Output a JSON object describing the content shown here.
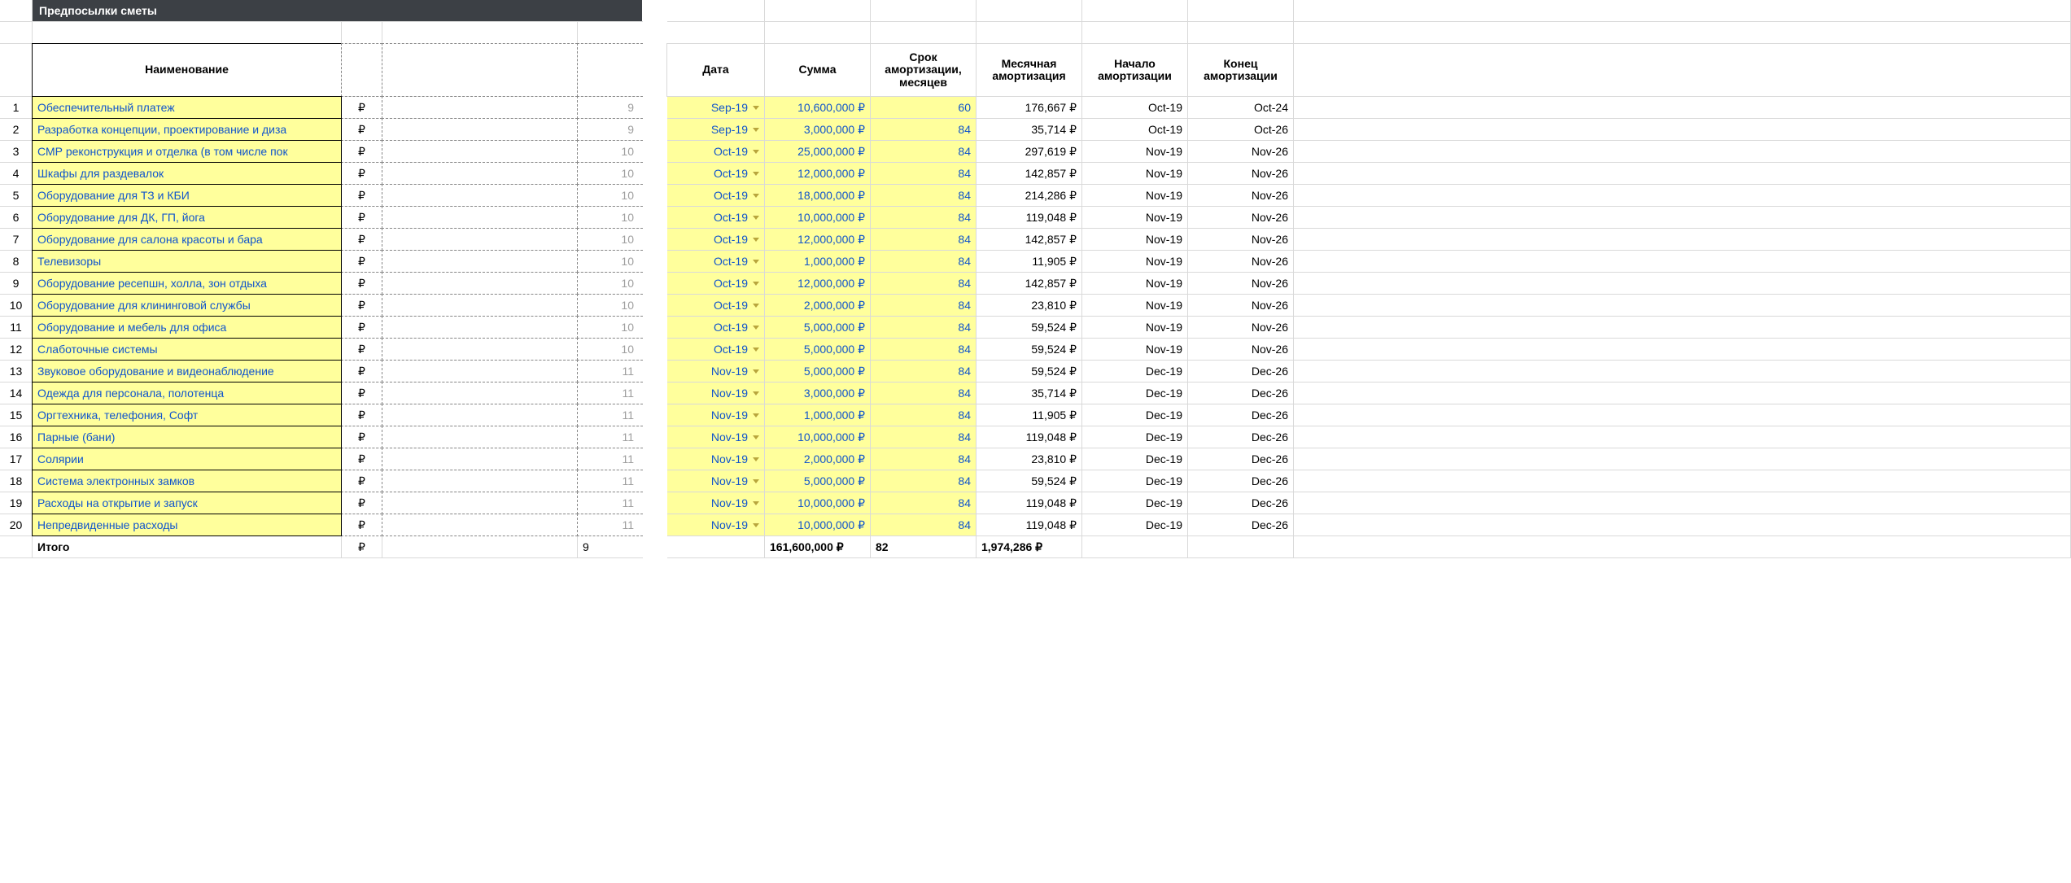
{
  "title": "Предпосылки сметы",
  "headers": {
    "name": "Наименование",
    "date": "Дата",
    "amount": "Сумма",
    "term": "Срок амортизации, месяцев",
    "mamort": "Месячная амортизация",
    "start": "Начало амортизации",
    "end": "Конец амортизации"
  },
  "currency_symbol": "₽",
  "rows": [
    {
      "n": "1",
      "name": "Обеспечительный платеж",
      "num": "9",
      "date": "Sep-19",
      "amount": "10,600,000 ₽",
      "term": "60",
      "mamort": "176,667 ₽",
      "start": "Oct-19",
      "end": "Oct-24"
    },
    {
      "n": "2",
      "name": "Разработка концепции, проектирование и диза",
      "num": "9",
      "date": "Sep-19",
      "amount": "3,000,000 ₽",
      "term": "84",
      "mamort": "35,714 ₽",
      "start": "Oct-19",
      "end": "Oct-26"
    },
    {
      "n": "3",
      "name": "СМР реконструкция и отделка (в том числе пок",
      "num": "10",
      "date": "Oct-19",
      "amount": "25,000,000 ₽",
      "term": "84",
      "mamort": "297,619 ₽",
      "start": "Nov-19",
      "end": "Nov-26"
    },
    {
      "n": "4",
      "name": "Шкафы для раздевалок",
      "num": "10",
      "date": "Oct-19",
      "amount": "12,000,000 ₽",
      "term": "84",
      "mamort": "142,857 ₽",
      "start": "Nov-19",
      "end": "Nov-26"
    },
    {
      "n": "5",
      "name": "Оборудование для ТЗ и КБИ",
      "num": "10",
      "date": "Oct-19",
      "amount": "18,000,000 ₽",
      "term": "84",
      "mamort": "214,286 ₽",
      "start": "Nov-19",
      "end": "Nov-26"
    },
    {
      "n": "6",
      "name": "Оборудование для ДК, ГП, йога",
      "num": "10",
      "date": "Oct-19",
      "amount": "10,000,000 ₽",
      "term": "84",
      "mamort": "119,048 ₽",
      "start": "Nov-19",
      "end": "Nov-26"
    },
    {
      "n": "7",
      "name": "Оборудование для салона красоты и бара",
      "num": "10",
      "date": "Oct-19",
      "amount": "12,000,000 ₽",
      "term": "84",
      "mamort": "142,857 ₽",
      "start": "Nov-19",
      "end": "Nov-26"
    },
    {
      "n": "8",
      "name": "Телевизоры",
      "num": "10",
      "date": "Oct-19",
      "amount": "1,000,000 ₽",
      "term": "84",
      "mamort": "11,905 ₽",
      "start": "Nov-19",
      "end": "Nov-26"
    },
    {
      "n": "9",
      "name": "Оборудование ресепшн, холла, зон отдыха",
      "num": "10",
      "date": "Oct-19",
      "amount": "12,000,000 ₽",
      "term": "84",
      "mamort": "142,857 ₽",
      "start": "Nov-19",
      "end": "Nov-26"
    },
    {
      "n": "10",
      "name": "Оборудование для клининговой службы",
      "num": "10",
      "date": "Oct-19",
      "amount": "2,000,000 ₽",
      "term": "84",
      "mamort": "23,810 ₽",
      "start": "Nov-19",
      "end": "Nov-26"
    },
    {
      "n": "11",
      "name": "Оборудование и мебель для офиса",
      "num": "10",
      "date": "Oct-19",
      "amount": "5,000,000 ₽",
      "term": "84",
      "mamort": "59,524 ₽",
      "start": "Nov-19",
      "end": "Nov-26"
    },
    {
      "n": "12",
      "name": "Слаботочные системы",
      "num": "10",
      "date": "Oct-19",
      "amount": "5,000,000 ₽",
      "term": "84",
      "mamort": "59,524 ₽",
      "start": "Nov-19",
      "end": "Nov-26"
    },
    {
      "n": "13",
      "name": "Звуковое оборудование и видеонаблюдение",
      "num": "11",
      "date": "Nov-19",
      "amount": "5,000,000 ₽",
      "term": "84",
      "mamort": "59,524 ₽",
      "start": "Dec-19",
      "end": "Dec-26"
    },
    {
      "n": "14",
      "name": "Одежда для персонала, полотенца",
      "num": "11",
      "date": "Nov-19",
      "amount": "3,000,000 ₽",
      "term": "84",
      "mamort": "35,714 ₽",
      "start": "Dec-19",
      "end": "Dec-26"
    },
    {
      "n": "15",
      "name": "Оргтехника, телефония, Софт",
      "num": "11",
      "date": "Nov-19",
      "amount": "1,000,000 ₽",
      "term": "84",
      "mamort": "11,905 ₽",
      "start": "Dec-19",
      "end": "Dec-26"
    },
    {
      "n": "16",
      "name": "Парные (бани)",
      "num": "11",
      "date": "Nov-19",
      "amount": "10,000,000 ₽",
      "term": "84",
      "mamort": "119,048 ₽",
      "start": "Dec-19",
      "end": "Dec-26"
    },
    {
      "n": "17",
      "name": "Солярии",
      "num": "11",
      "date": "Nov-19",
      "amount": "2,000,000 ₽",
      "term": "84",
      "mamort": "23,810 ₽",
      "start": "Dec-19",
      "end": "Dec-26"
    },
    {
      "n": "18",
      "name": "Система электронных замков",
      "num": "11",
      "date": "Nov-19",
      "amount": "5,000,000 ₽",
      "term": "84",
      "mamort": "59,524 ₽",
      "start": "Dec-19",
      "end": "Dec-26"
    },
    {
      "n": "19",
      "name": "Расходы на открытие и запуск",
      "num": "11",
      "date": "Nov-19",
      "amount": "10,000,000 ₽",
      "term": "84",
      "mamort": "119,048 ₽",
      "start": "Dec-19",
      "end": "Dec-26"
    },
    {
      "n": "20",
      "name": "Непредвиденные расходы",
      "num": "11",
      "date": "Nov-19",
      "amount": "10,000,000 ₽",
      "term": "84",
      "mamort": "119,048 ₽",
      "start": "Dec-19",
      "end": "Dec-26"
    }
  ],
  "total": {
    "label": "Итого",
    "num": "9",
    "amount": "161,600,000 ₽",
    "term": "82",
    "mamort": "1,974,286 ₽"
  }
}
